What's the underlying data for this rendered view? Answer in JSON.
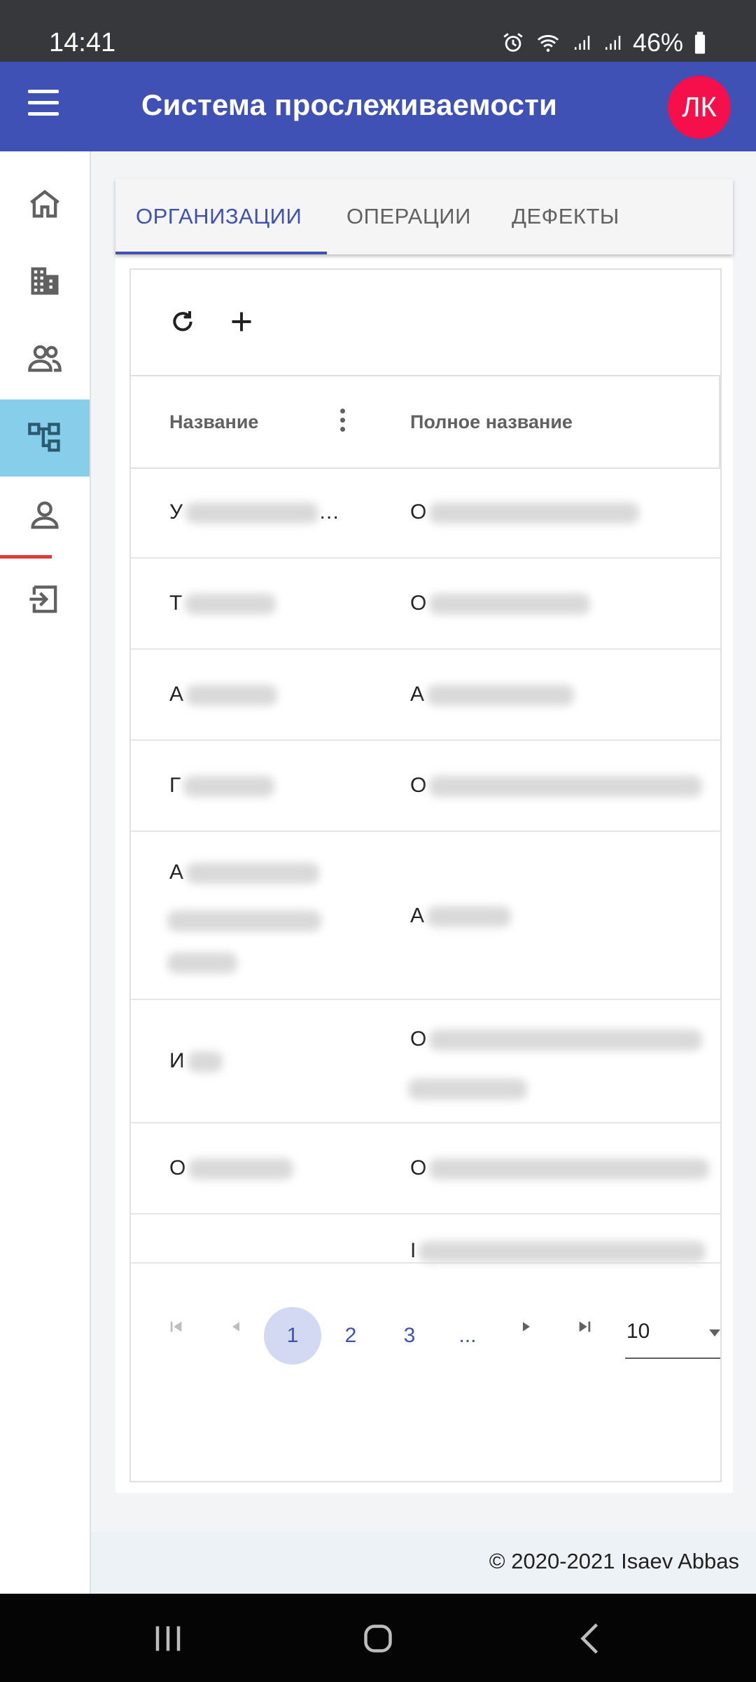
{
  "status_bar": {
    "time": "14:41",
    "battery": "46%",
    "icons": [
      "alarm-icon",
      "wifi-icon",
      "signal-icon",
      "signal-icon",
      "battery-icon"
    ]
  },
  "app_bar": {
    "title": "Система прослеживаемости",
    "avatar_initials": "ЛК",
    "accent": "#3f51b5",
    "avatar_color": "#f50f4b"
  },
  "sidebar": {
    "items": [
      {
        "icon": "home-icon",
        "active": false
      },
      {
        "icon": "building-icon",
        "active": false
      },
      {
        "icon": "people-icon",
        "active": false
      },
      {
        "icon": "hierarchy-icon",
        "active": true
      },
      {
        "icon": "person-icon",
        "active": false
      },
      {
        "icon": "logout-icon",
        "active": false
      }
    ],
    "active_color": "#87ceeb"
  },
  "tabs": [
    {
      "label": "ОРГАНИЗАЦИИ",
      "active": true
    },
    {
      "label": "ОПЕРАЦИИ",
      "active": false
    },
    {
      "label": "ДЕФЕКТЫ",
      "active": false
    }
  ],
  "toolbar": {
    "refresh_icon": "refresh-icon",
    "add_icon": "add-icon"
  },
  "table": {
    "columns": [
      "Название",
      "Полное название"
    ],
    "rows": [
      {
        "name": "У",
        "name_suffix": "…",
        "full": "О"
      },
      {
        "name": "Т",
        "full": "О"
      },
      {
        "name": "А",
        "full": "А"
      },
      {
        "name": "Г",
        "full": "О"
      },
      {
        "name": "А",
        "full": "А"
      },
      {
        "name": "И",
        "full": "О"
      },
      {
        "name": "О",
        "full": "О"
      },
      {
        "name": "",
        "full": "I"
      }
    ]
  },
  "pagination": {
    "pages": [
      "1",
      "2",
      "3",
      "..."
    ],
    "current_page": "1",
    "page_size": "10"
  },
  "footer": {
    "text": "© 2020-2021 Isaev Abbas"
  }
}
